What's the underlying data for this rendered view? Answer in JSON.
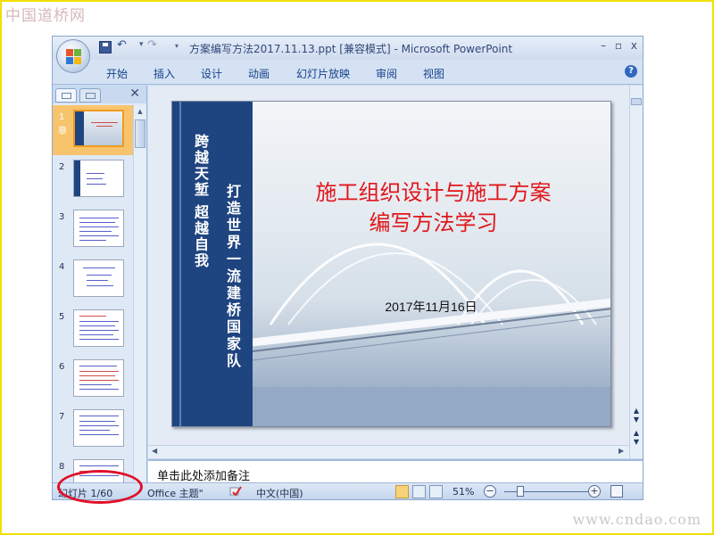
{
  "watermark": {
    "top_text": "中国道桥网",
    "bottom_text": "www.cndao.com"
  },
  "window": {
    "title": "方案编写方法2017.11.13.ppt [兼容模式] - Microsoft PowerPoint",
    "controls": [
      "–",
      "▫",
      "x"
    ]
  },
  "ribbon": {
    "tabs": [
      "开始",
      "插入",
      "设计",
      "动画",
      "幻灯片放映",
      "审阅",
      "视图"
    ],
    "help_icon": "?"
  },
  "slides_panel": {
    "close_symbol": "✕",
    "items": [
      {
        "number": "1",
        "label": "章"
      },
      {
        "number": "2"
      },
      {
        "number": "3"
      },
      {
        "number": "4"
      },
      {
        "number": "5"
      },
      {
        "number": "6"
      },
      {
        "number": "7"
      },
      {
        "number": "8"
      }
    ]
  },
  "slide": {
    "vertical_text_left": "跨越天堑 超越自我",
    "vertical_text_right": "打造世界一流建桥国家队",
    "title_line1": "施工组织设计与施工方案",
    "title_line2": "编写方法学习",
    "date": "2017年11月16日"
  },
  "notes": {
    "placeholder": "单击此处添加备注"
  },
  "statusbar": {
    "slide_position": "幻灯片 1/60",
    "theme": "Office 主题\"",
    "language": "中文(中国)",
    "zoom": "51%",
    "zoom_minus": "−",
    "zoom_plus": "+"
  },
  "colors": {
    "slide_title": "#e1161b",
    "slide_band": "#1f4580",
    "highlight_circle": "#e0102a",
    "active_thumbnail": "#f7c46d"
  }
}
